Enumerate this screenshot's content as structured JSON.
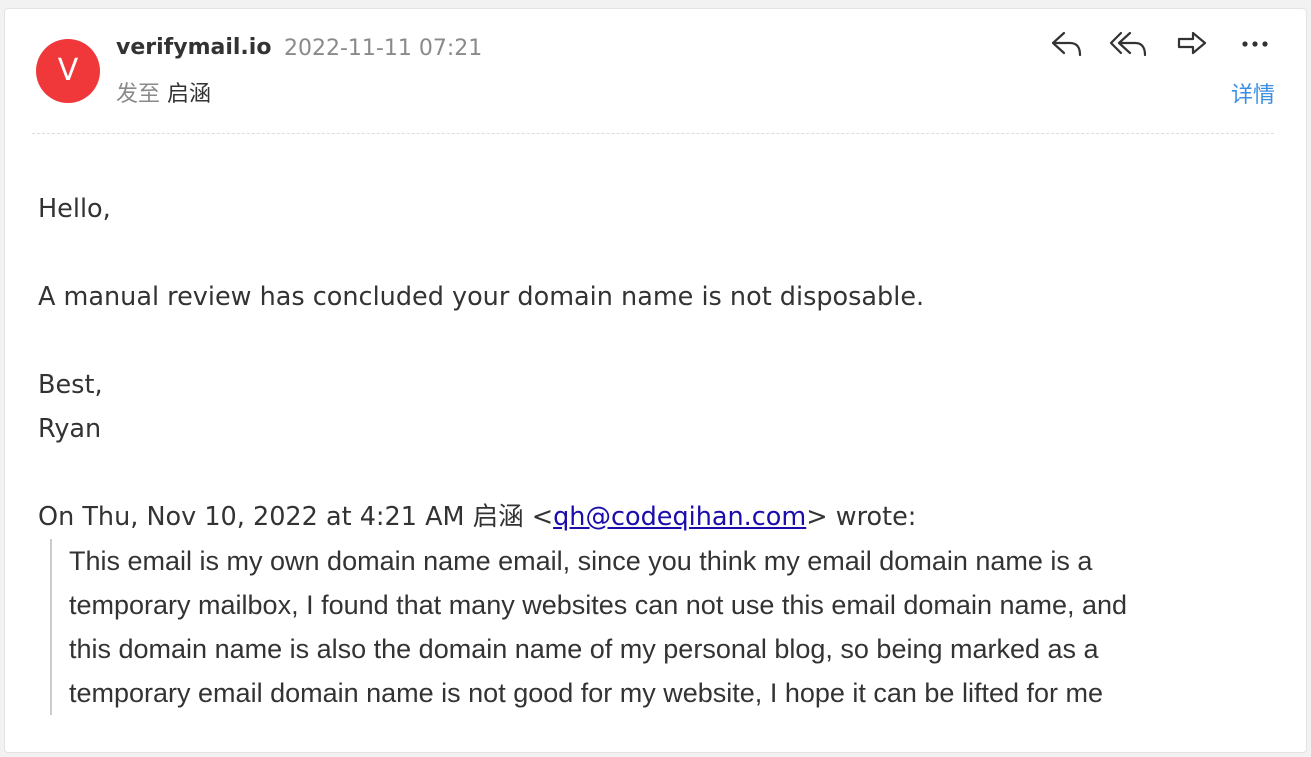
{
  "header": {
    "avatar_letter": "V",
    "sender": "verifymail.io",
    "date": "2022-11-11 07:21",
    "sent_to_label": "发至",
    "recipient": "启涵",
    "details_label": "详情",
    "icons": [
      "reply-icon",
      "reply-all-icon",
      "forward-icon",
      "more-icon"
    ]
  },
  "message": {
    "greeting": "Hello,",
    "line1": "A manual review has concluded your domain name is not disposable.",
    "signoff": "Best,",
    "signature": "Ryan",
    "quote_intro_prefix": "On Thu, Nov 10, 2022 at 4:21 AM 启涵 <",
    "quote_email": "qh@codeqihan.com",
    "quote_intro_suffix": "> wrote:",
    "quoted_lines": [
      "This email is my own domain name email, since you think my email domain name is a",
      "temporary mailbox, I found that many websites can not use this email domain name, and",
      "this domain name is also the domain name of my personal blog, so being marked as a",
      "temporary email domain name is not good for my website, I hope it can be lifted for me"
    ]
  },
  "colors": {
    "avatar": "#f0383b",
    "link_blue": "#3b8fe3",
    "mail_link": "#1a0dab"
  }
}
